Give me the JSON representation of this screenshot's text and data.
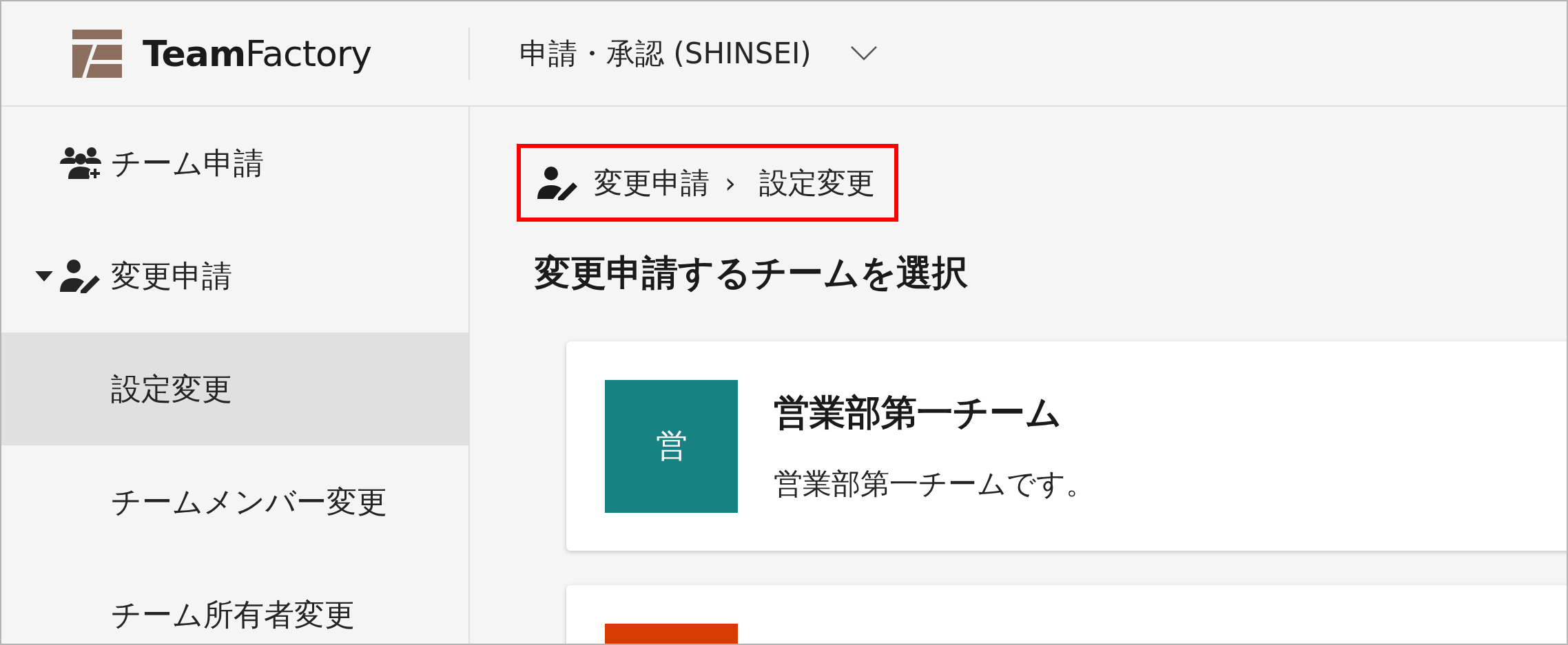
{
  "header": {
    "logo_text": "**Team**Factory",
    "app_switcher": {
      "label": "申請・承認 (SHINSEI)",
      "expanded": false
    }
  },
  "sidebar": {
    "items": [
      {
        "label": "チーム申請",
        "kind": "team-add",
        "expanded": false
      },
      {
        "label": "変更申請",
        "kind": "user-edit",
        "expanded": true,
        "children": [
          {
            "label": "設定変更",
            "selected": true
          },
          {
            "label": "チームメンバー変更",
            "selected": false
          },
          {
            "label": "チーム所有者変更",
            "selected": false
          }
        ]
      }
    ]
  },
  "breadcrumb": {
    "highlighted": true,
    "items": [
      "変更申請",
      "設定変更"
    ],
    "separator": "›"
  },
  "heading": "変更申請するチームを選択",
  "teams": [
    {
      "initial": "営",
      "name": "営業部第一チーム",
      "description": "営業部第一チームです。",
      "color": "#188282"
    },
    {
      "color": "#d83b01"
    }
  ]
}
